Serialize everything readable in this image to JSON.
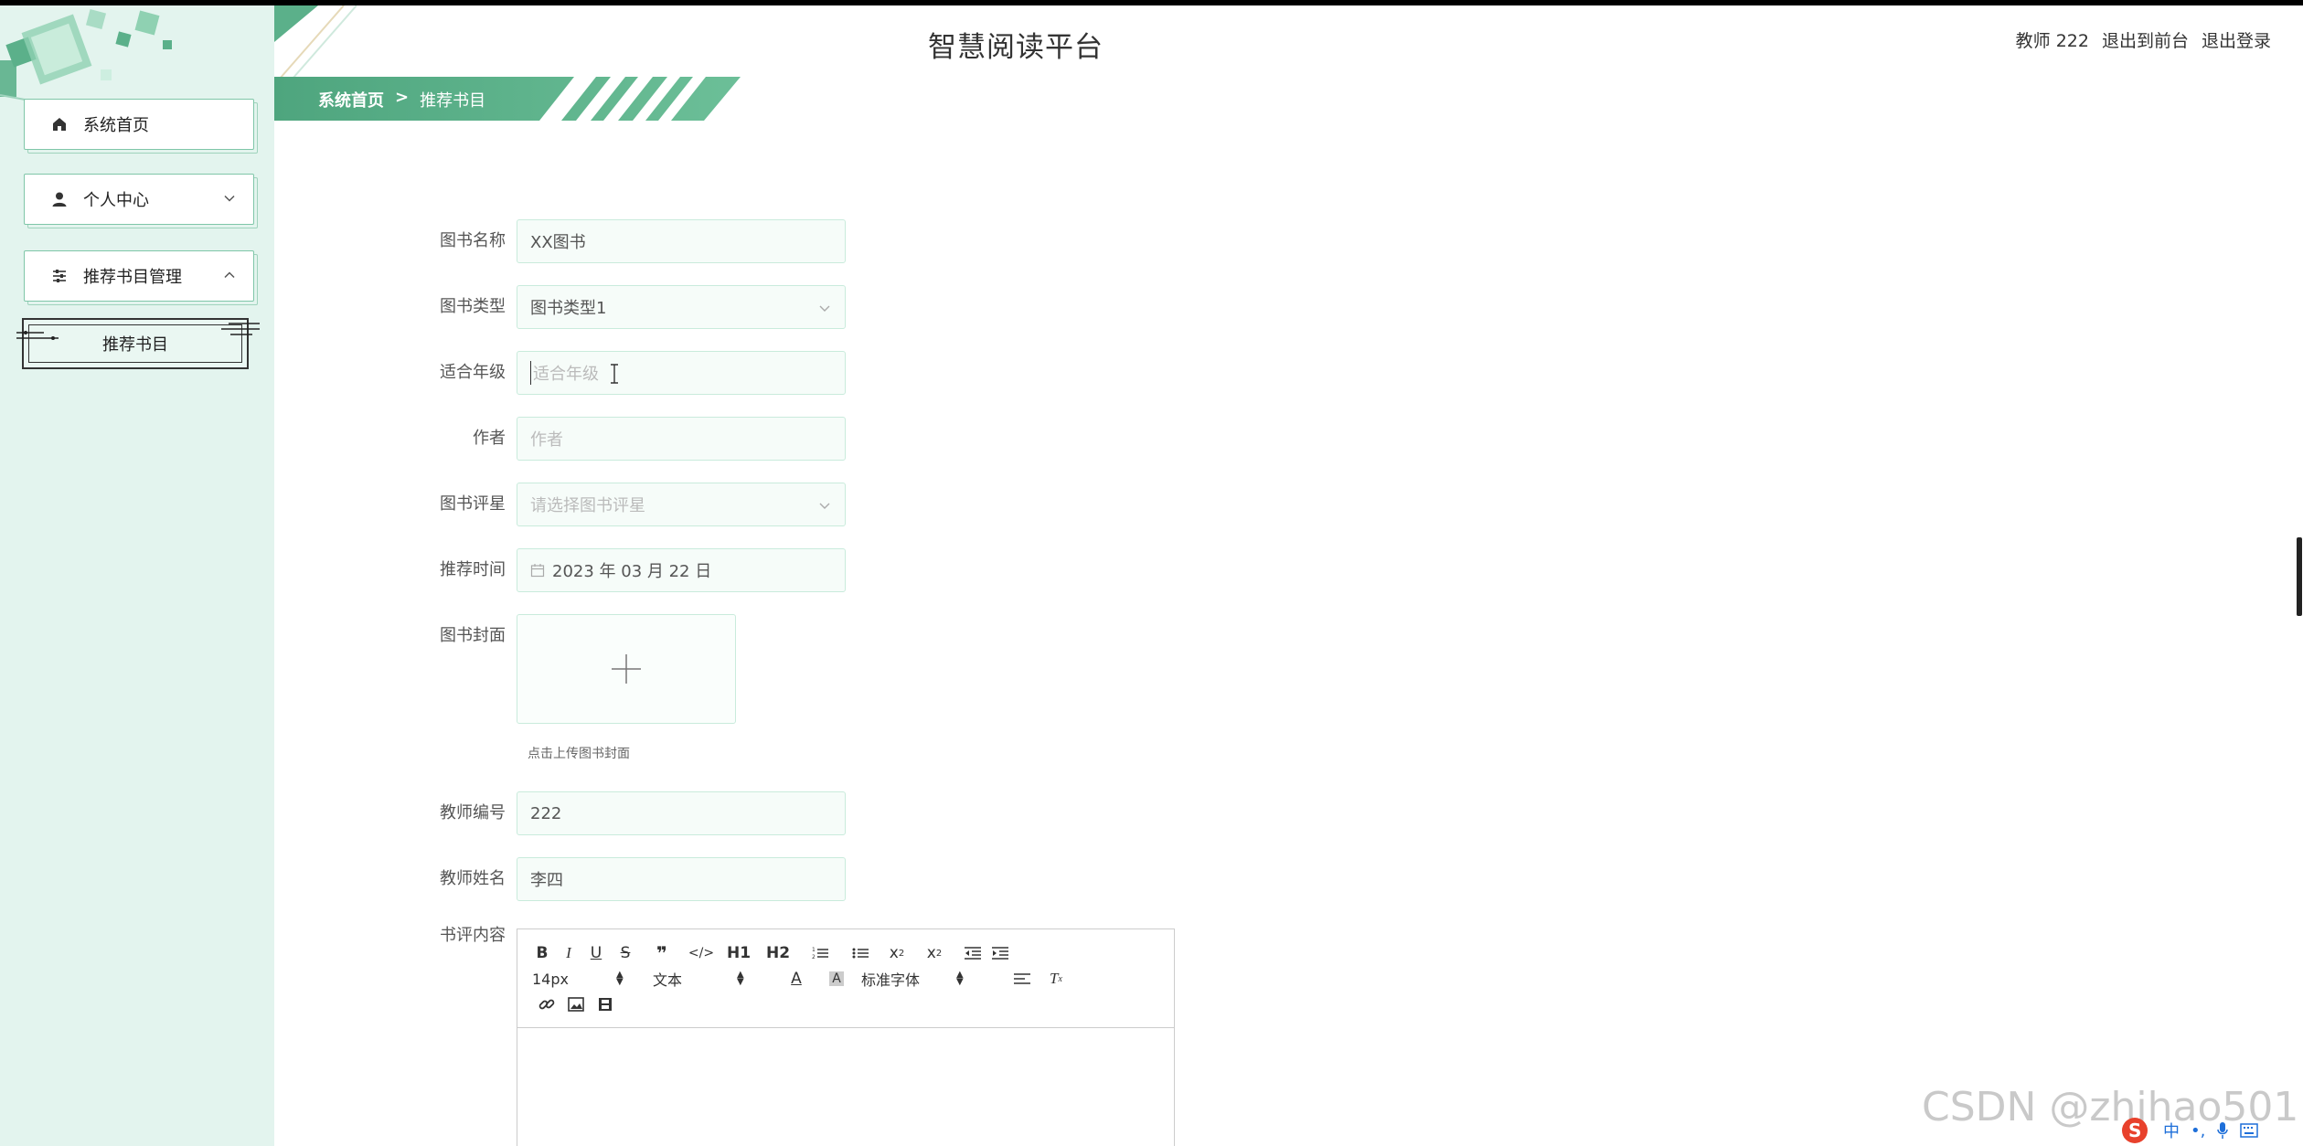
{
  "header": {
    "title": "智慧阅读平台",
    "user": "教师 222",
    "to_front": "退出到前台",
    "logout": "退出登录"
  },
  "breadcrumb": {
    "home": "系统首页",
    "sep": ">",
    "current": "推荐书目"
  },
  "sidebar": {
    "items": [
      {
        "label": "系统首页",
        "icon": "home-icon"
      },
      {
        "label": "个人中心",
        "icon": "user-icon"
      },
      {
        "label": "推荐书目管理",
        "icon": "sliders-icon"
      }
    ],
    "submenu": {
      "label": "推荐书目"
    }
  },
  "form": {
    "book_name": {
      "label": "图书名称",
      "value": "XX图书"
    },
    "book_type": {
      "label": "图书类型",
      "value": "图书类型1"
    },
    "grade": {
      "label": "适合年级",
      "placeholder": "适合年级"
    },
    "author": {
      "label": "作者",
      "placeholder": "作者"
    },
    "rating": {
      "label": "图书评星",
      "placeholder": "请选择图书评星"
    },
    "time": {
      "label": "推荐时间",
      "value": "2023 年 03 月 22 日"
    },
    "cover": {
      "label": "图书封面",
      "tip": "点击上传图书封面"
    },
    "teacher_no": {
      "label": "教师编号",
      "value": "222"
    },
    "teacher_name": {
      "label": "教师姓名",
      "value": "李四"
    },
    "review": {
      "label": "书评内容"
    }
  },
  "editor": {
    "font_size": "14px",
    "block": "文本",
    "font_family": "标准字体",
    "h1": "H1",
    "h2": "H2"
  },
  "watermark": "CSDN @zhihao501",
  "tray": {
    "ime": "中"
  },
  "colors": {
    "accent": "#5bb08a",
    "sidebar_bg": "#e3f4ee",
    "input_border": "#c9ebdc"
  }
}
